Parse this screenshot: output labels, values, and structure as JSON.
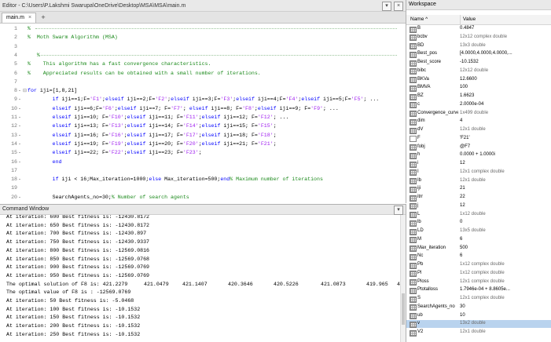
{
  "editor": {
    "title": "Editor - C:\\Users\\P.Lakshmi Swarupa\\OneDrive\\Desktop\\MSA\\MSA\\main.m",
    "tab_label": "main.m",
    "close_glyph": "×",
    "add_glyph": "+",
    "lines": [
      {
        "n": "1",
        "k": "cm",
        "t": "%"
      },
      {
        "n": "2",
        "k": "cm",
        "t": "%  Moth Swarm Algorithm (MSA)"
      },
      {
        "n": "3",
        "k": "cm",
        "t": ""
      },
      {
        "n": "4",
        "k": "cm",
        "t": "   %"
      },
      {
        "n": "5",
        "k": "cm",
        "t": "%    This algorithm has a fast convergence characteristics."
      },
      {
        "n": "6",
        "k": "cm",
        "t": "%    Appreciated results can be obtained with a small number of iterations."
      },
      {
        "n": "7",
        "k": "nm",
        "t": ""
      },
      {
        "n": "8",
        "k": "code",
        "t": "for iji=[1,8,21]"
      },
      {
        "n": "9",
        "k": "code",
        "t": "        if iji==1;F='F1';elseif iji==2;F='F2';elseif iji==3;F='F3';elseif iji==4;F='F4';elseif iji==5;F='F5'; ..."
      },
      {
        "n": "10",
        "k": "code",
        "t": "        elseif iji==6;F='F6';elseif iji==7; F='F7'; elseif iji==8; F='F8';elseif iji==9; F='F9'; ..."
      },
      {
        "n": "11",
        "k": "code",
        "t": "        elseif iji==10; F='F10';elseif iji==11; F='F11';elseif iji==12; F='F12'; ..."
      },
      {
        "n": "12",
        "k": "code",
        "t": "        elseif iji==13; F='F13';elseif iji==14; F='F14';elseif iji==15; F='F15';"
      },
      {
        "n": "13",
        "k": "code",
        "t": "        elseif iji==16; F='F16';elseif iji==17; F='F17';elseif iji==18; F='F18';"
      },
      {
        "n": "14",
        "k": "code",
        "t": "        elseif iji==19; F='F19';elseif iji==20; F='F20';elseif iji==21; F='F21';"
      },
      {
        "n": "15",
        "k": "code",
        "t": "        elseif iji==22; F='F22';elseif iji==23; F='F23';"
      },
      {
        "n": "16",
        "k": "code",
        "t": "        end"
      },
      {
        "n": "17",
        "k": "nm",
        "t": ""
      },
      {
        "n": "18",
        "k": "code",
        "t": "        if iji < 16;Max_iteration=1000;else Max_iteration=500;end% Maximum number of iterations"
      },
      {
        "n": "19",
        "k": "nm",
        "t": ""
      },
      {
        "n": "20",
        "k": "code",
        "t": "        SearchAgents_no=30;% Number of search agents"
      }
    ]
  },
  "command_window": {
    "title": "Command Window",
    "lines": [
      "At iteration: 600 Best fitness is: -12430.8172",
      "At iteration: 650 Best fitness is: -12430.8172",
      "At iteration: 700 Best fitness is: -12430.897",
      "At iteration: 750 Best fitness is: -12430.9337",
      "At iteration: 800 Best fitness is: -12569.0816",
      "At iteration: 850 Best fitness is: -12569.0768",
      "At iteration: 900 Best fitness is: -12569.0769",
      "At iteration: 950 Best fitness is: -12569.0769",
      "The optimal solution of F8 is: 421.2279",
      "The optimal value of F8 is : -12569.0769",
      "At iteration: 50 Best fitness is: -5.0468",
      "At iteration: 100 Best fitness is: -10.1532",
      "At iteration: 150 Best fitness is: -10.1532",
      "At iteration: 200 Best fitness is: -10.1532",
      "At iteration: 250 Best fitness is: -10.1532"
    ],
    "solution_values": [
      "421.0479",
      "421.1407",
      "420.3646",
      "420.5226",
      "421.0873",
      "419.965",
      "42"
    ]
  },
  "workspace": {
    "title": "Workspace",
    "col_name": "Name ^",
    "col_value": "Value",
    "rows": [
      {
        "name": "B",
        "value": "0.4847",
        "type": "num"
      },
      {
        "name": "bcbv",
        "value": "12x12 complex double",
        "type": "num"
      },
      {
        "name": "BD",
        "value": "13x3 double",
        "type": "num"
      },
      {
        "name": "Best_pos",
        "value": "[4.0000,4.0000,4.0000,...",
        "type": "num"
      },
      {
        "name": "Best_score",
        "value": "-10.1532",
        "type": "num"
      },
      {
        "name": "bibc",
        "value": "12x12 double",
        "type": "num"
      },
      {
        "name": "BKVa",
        "value": "12.6600",
        "type": "num"
      },
      {
        "name": "BMVA",
        "value": "100",
        "type": "num"
      },
      {
        "name": "BZ",
        "value": "1.6623",
        "type": "num"
      },
      {
        "name": "c",
        "value": "2.0000e-04",
        "type": "num"
      },
      {
        "name": "Convergence_curve",
        "value": "1x499 double",
        "type": "num"
      },
      {
        "name": "dim",
        "value": "4",
        "type": "num"
      },
      {
        "name": "dV",
        "value": "12x1 double",
        "type": "num"
      },
      {
        "name": "F",
        "value": "'F21'",
        "type": "str"
      },
      {
        "name": "fobj",
        "value": "@F7",
        "type": "num"
      },
      {
        "name": "h",
        "value": "0.0000 + 1.0000i",
        "type": "num"
      },
      {
        "name": "i",
        "value": "12",
        "type": "num"
      },
      {
        "name": "I",
        "value": "12x1 complex double",
        "type": "num"
      },
      {
        "name": "Ib",
        "value": "12x1 double",
        "type": "num"
      },
      {
        "name": "iji",
        "value": "21",
        "type": "num"
      },
      {
        "name": "itrr",
        "value": "22",
        "type": "num"
      },
      {
        "name": "j",
        "value": "12",
        "type": "num"
      },
      {
        "name": "L",
        "value": "1x12 double",
        "type": "num"
      },
      {
        "name": "lb",
        "value": "0",
        "type": "num"
      },
      {
        "name": "LD",
        "value": "13x5 double",
        "type": "num"
      },
      {
        "name": "M",
        "value": "6",
        "type": "num"
      },
      {
        "name": "Max_iteration",
        "value": "500",
        "type": "num"
      },
      {
        "name": "Nc",
        "value": "6",
        "type": "num"
      },
      {
        "name": "Pb",
        "value": "1x12 complex double",
        "type": "num"
      },
      {
        "name": "Pl",
        "value": "1x12 complex double",
        "type": "num"
      },
      {
        "name": "Ploss",
        "value": "12x1 complex double",
        "type": "num"
      },
      {
        "name": "Ptotalloss",
        "value": "1.7946e-04 + 8.8605e...",
        "type": "num"
      },
      {
        "name": "S",
        "value": "12x1 complex double",
        "type": "num"
      },
      {
        "name": "SearchAgents_no",
        "value": "30",
        "type": "num"
      },
      {
        "name": "ub",
        "value": "10",
        "type": "num"
      },
      {
        "name": "v",
        "value": "13x2 double",
        "type": "num",
        "selected": true
      },
      {
        "name": "V2",
        "value": "12x1 double",
        "type": "num"
      }
    ]
  }
}
